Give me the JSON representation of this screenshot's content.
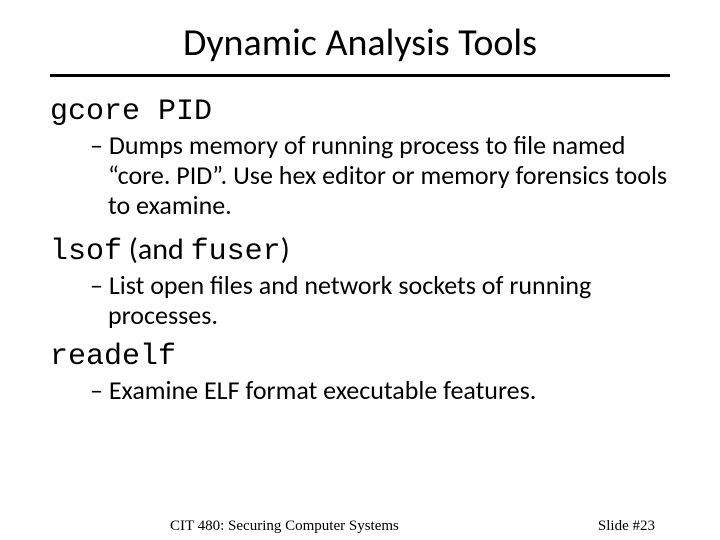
{
  "title": "Dynamic Analysis Tools",
  "items": [
    {
      "cmd": "gcore PID",
      "desc": "Dumps memory of running process to file named “core. PID”. Use hex editor or memory forensics tools to examine."
    },
    {
      "cmd_html": "lsof",
      "cmd_tail": " (and ",
      "cmd_tail2": "fuser",
      "cmd_tail3": ")",
      "desc": "List open files and network sockets of running processes."
    },
    {
      "cmd": "readelf",
      "desc": "Examine ELF format executable features."
    }
  ],
  "footer": {
    "left": "CIT 480: Securing Computer Systems",
    "right": "Slide #23"
  }
}
